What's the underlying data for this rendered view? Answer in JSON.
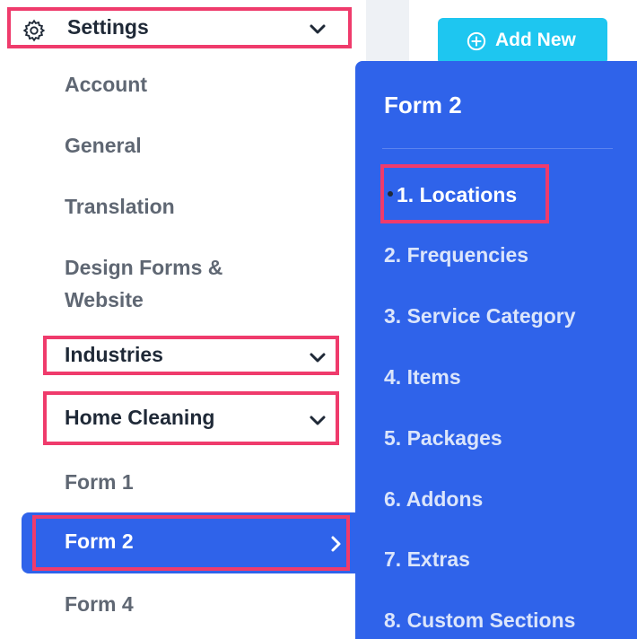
{
  "sidebar": {
    "settings_label": "Settings",
    "items": [
      {
        "label": "Account"
      },
      {
        "label": "General"
      },
      {
        "label": "Translation"
      },
      {
        "label": "Design Forms & Website"
      },
      {
        "label": "Industries"
      },
      {
        "label": "Home Cleaning"
      },
      {
        "label": "Form 1"
      },
      {
        "label": "Form 2"
      },
      {
        "label": "Form 4"
      }
    ]
  },
  "header": {
    "add_new_label": "Add New"
  },
  "submenu": {
    "title": "Form 2",
    "items": [
      {
        "label": "1. Locations"
      },
      {
        "label": "2. Frequencies"
      },
      {
        "label": "3. Service Category"
      },
      {
        "label": "4. Items"
      },
      {
        "label": "5. Packages"
      },
      {
        "label": "6. Addons"
      },
      {
        "label": "7. Extras"
      },
      {
        "label": "8. Custom Sections"
      }
    ]
  },
  "colors": {
    "accent": "#2f63ea",
    "highlight": "#ef3b6c",
    "button": "#1ec6f0"
  }
}
